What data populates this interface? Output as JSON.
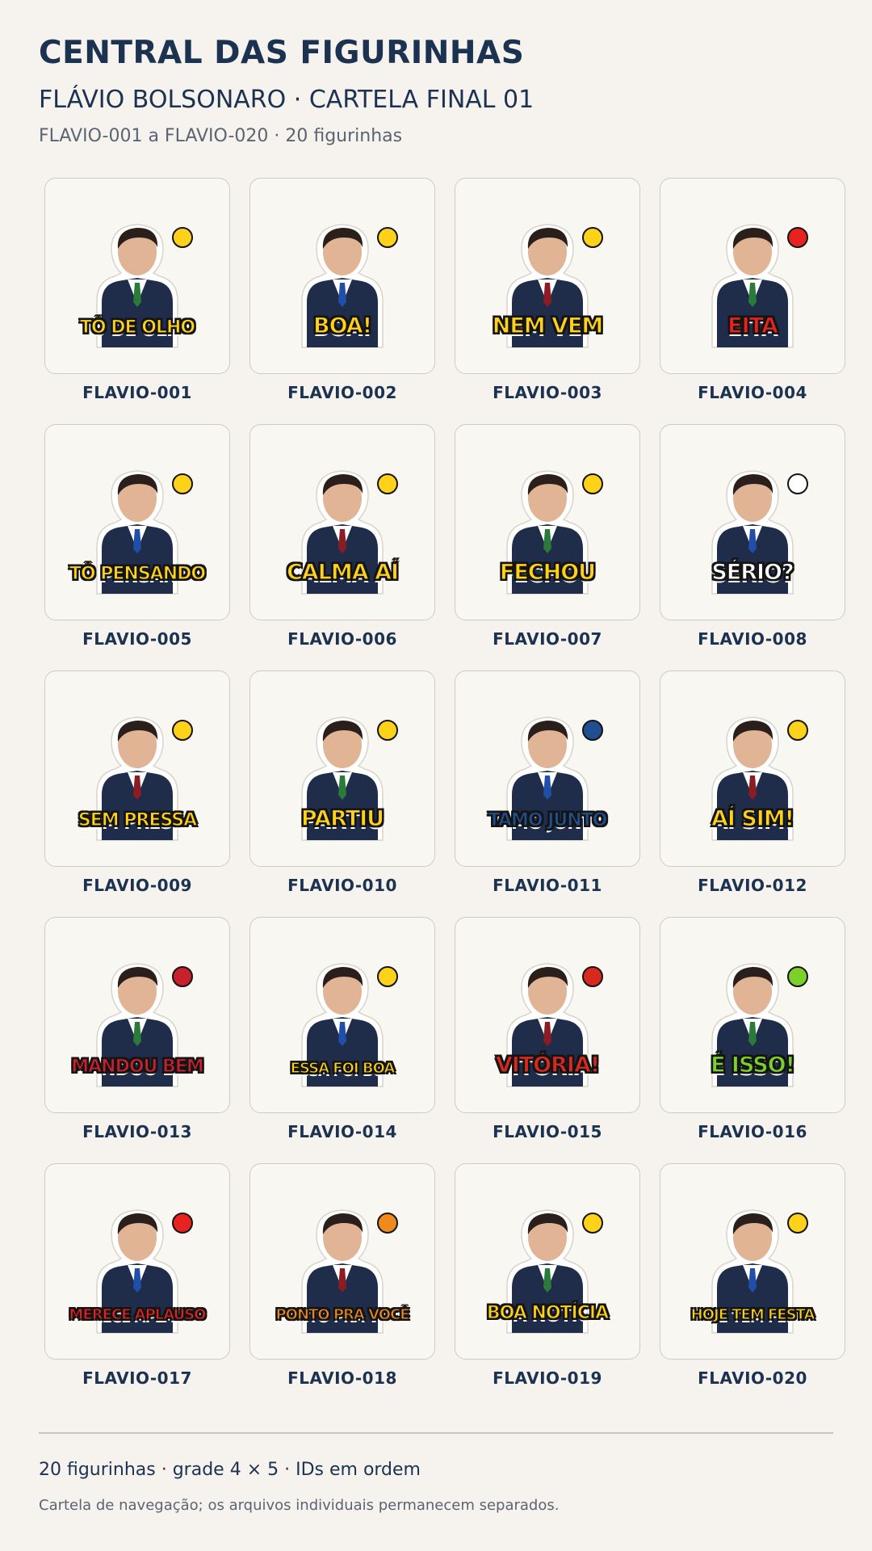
{
  "header": {
    "title": "CENTRAL DAS FIGURINHAS",
    "subtitle": "FLÁVIO BOLSONARO · CARTELA FINAL 01",
    "range": "FLAVIO-001 a FLAVIO-020 · 20 figurinhas"
  },
  "stickers": [
    {
      "id": "FLAVIO-001",
      "caption": "TÔ DE OLHO",
      "accent": "#ffd21a",
      "suit": "#1f2d4a",
      "extra": "eyes-icon"
    },
    {
      "id": "FLAVIO-002",
      "caption": "BOA!",
      "accent": "#ffd21a",
      "suit": "#1f2d4a",
      "extra": "clap-icon"
    },
    {
      "id": "FLAVIO-003",
      "caption": "NEM VEM",
      "accent": "#ffd21a",
      "suit": "#1f2d4a",
      "extra": "stop-hand-icon"
    },
    {
      "id": "FLAVIO-004",
      "caption": "EITA",
      "accent": "#e8231f",
      "suit": "#1f2d4a",
      "extra": "jack-in-the-box-icon"
    },
    {
      "id": "FLAVIO-005",
      "caption": "TÔ PENSANDO",
      "accent": "#ffd21a",
      "suit": "#1f2d4a",
      "extra": "thought-bubble-icon"
    },
    {
      "id": "FLAVIO-006",
      "caption": "CALMA AÍ",
      "accent": "#ffd21a",
      "suit": "#1f2d4a",
      "extra": "calm-hands-icon"
    },
    {
      "id": "FLAVIO-007",
      "caption": "FECHOU",
      "accent": "#ffd21a",
      "suit": "#1f2d4a",
      "extra": "handshake-icon"
    },
    {
      "id": "FLAVIO-008",
      "caption": "SÉRIO?",
      "accent": "#ffffff",
      "suit": "#1f2d4a",
      "extra": "speech-bubble-icon"
    },
    {
      "id": "FLAVIO-009",
      "caption": "SEM PRESSA",
      "accent": "#ffd21a",
      "suit": "#1f2d4a",
      "extra": "snail-icon"
    },
    {
      "id": "FLAVIO-010",
      "caption": "PARTIU",
      "accent": "#ffd21a",
      "suit": "#1f2d4a",
      "extra": "green-arrow-icon"
    },
    {
      "id": "FLAVIO-011",
      "caption": "TAMO JUNTO",
      "accent": "#1f4f8f",
      "suit": "#1f2d4a",
      "extra": "hand-on-heart-icon"
    },
    {
      "id": "FLAVIO-012",
      "caption": "AÍ SIM!",
      "accent": "#ffd21a",
      "suit": "#1f2d4a",
      "extra": "bell-icon"
    },
    {
      "id": "FLAVIO-013",
      "caption": "MANDOU BEM",
      "accent": "#c8202c",
      "suit": "#1f2d4a",
      "extra": "medal-icon"
    },
    {
      "id": "FLAVIO-014",
      "caption": "ESSA FOI BOA",
      "accent": "#ffd21a",
      "suit": "#1f2d4a",
      "extra": "laugh-icon"
    },
    {
      "id": "FLAVIO-015",
      "caption": "VITÓRIA!",
      "accent": "#d9281e",
      "suit": "#1f2d4a",
      "extra": "podium-icon"
    },
    {
      "id": "FLAVIO-016",
      "caption": "É ISSO!",
      "accent": "#7bd12a",
      "suit": "#1f2d4a",
      "extra": "fist-icon"
    },
    {
      "id": "FLAVIO-017",
      "caption": "MERECE APLAUSO",
      "accent": "#e8231f",
      "suit": "#1f2d4a",
      "extra": "applause-sign-icon"
    },
    {
      "id": "FLAVIO-018",
      "caption": "PONTO PRA VOCÊ",
      "accent": "#f08a1c",
      "suit": "#1f2d4a",
      "extra": "scoreboard-icon"
    },
    {
      "id": "FLAVIO-019",
      "caption": "BOA NOTÍCIA",
      "accent": "#ffd21a",
      "suit": "#1f2d4a",
      "extra": "sun-icon"
    },
    {
      "id": "FLAVIO-020",
      "caption": "HOJE TEM FESTA",
      "accent": "#ffd21a",
      "suit": "#1f2d4a",
      "extra": "confetti-icon"
    }
  ],
  "footer": {
    "summary": "20 figurinhas · grade 4 × 5 · IDs em ordem",
    "note": "Cartela de navegação; os arquivos individuais permanecem separados."
  }
}
